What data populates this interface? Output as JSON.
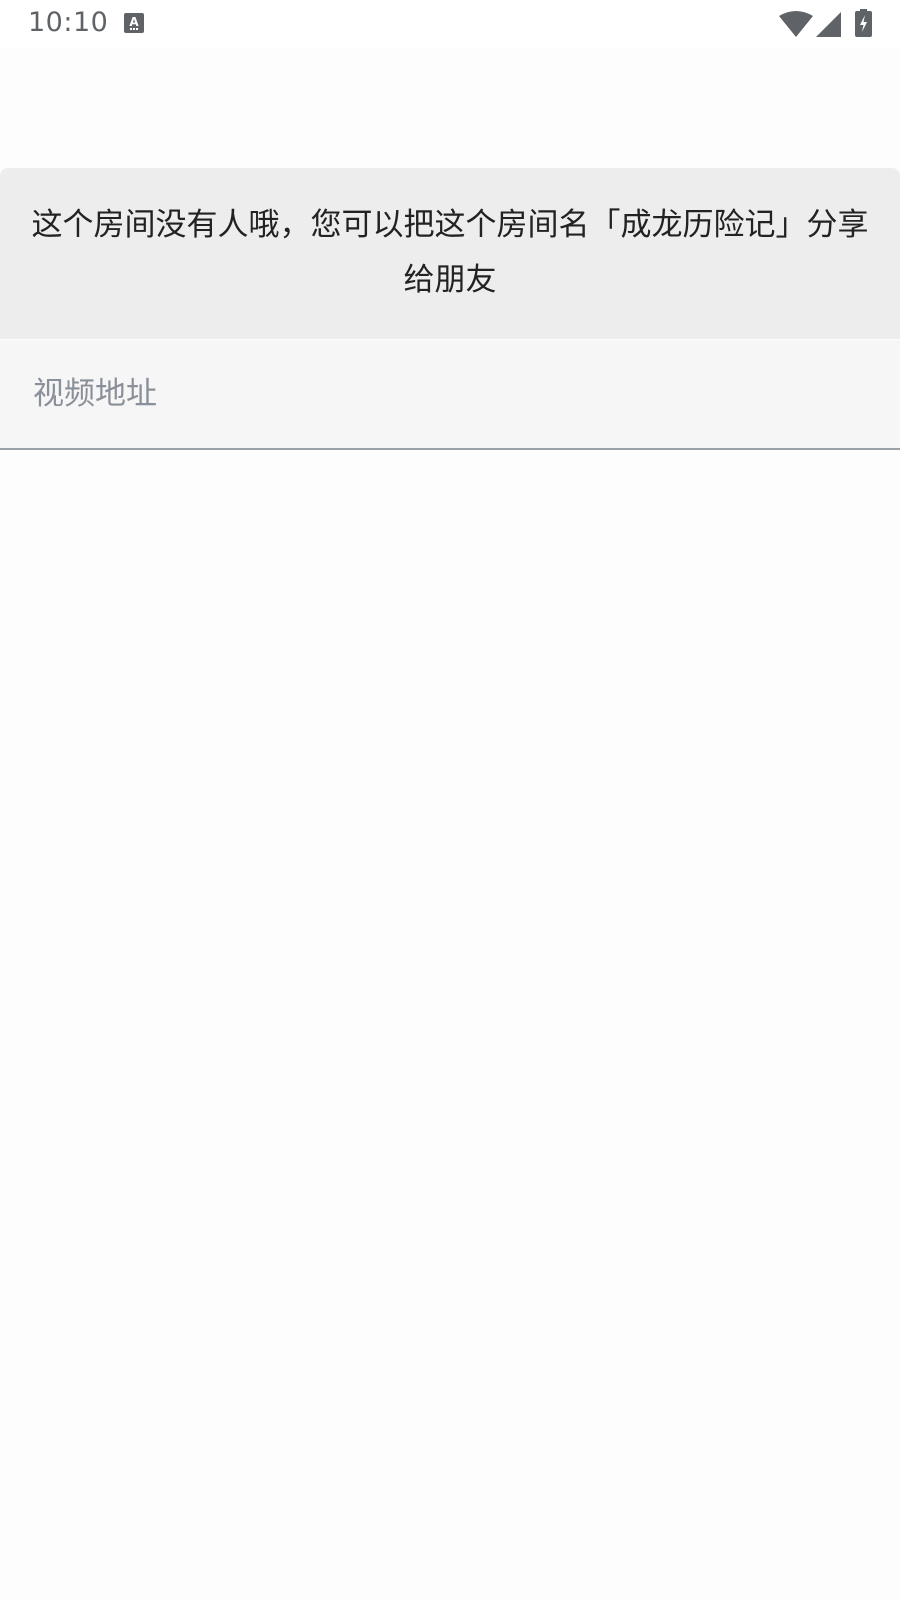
{
  "status_bar": {
    "time": "10:10",
    "notification_icon": "text-a-icon",
    "wifi_icon": "wifi-icon",
    "signal_icon": "cell-signal-icon",
    "battery_icon": "battery-charging-icon"
  },
  "notice": {
    "message": "这个房间没有人哦，您可以把这个房间名「成龙历险记」分享给朋友"
  },
  "video_url": {
    "placeholder": "视频地址",
    "value": ""
  },
  "colors": {
    "notice_background": "#ededed",
    "field_background": "#f6f6f6",
    "underline": "#9aa0a8",
    "placeholder_text": "#8a9099"
  }
}
